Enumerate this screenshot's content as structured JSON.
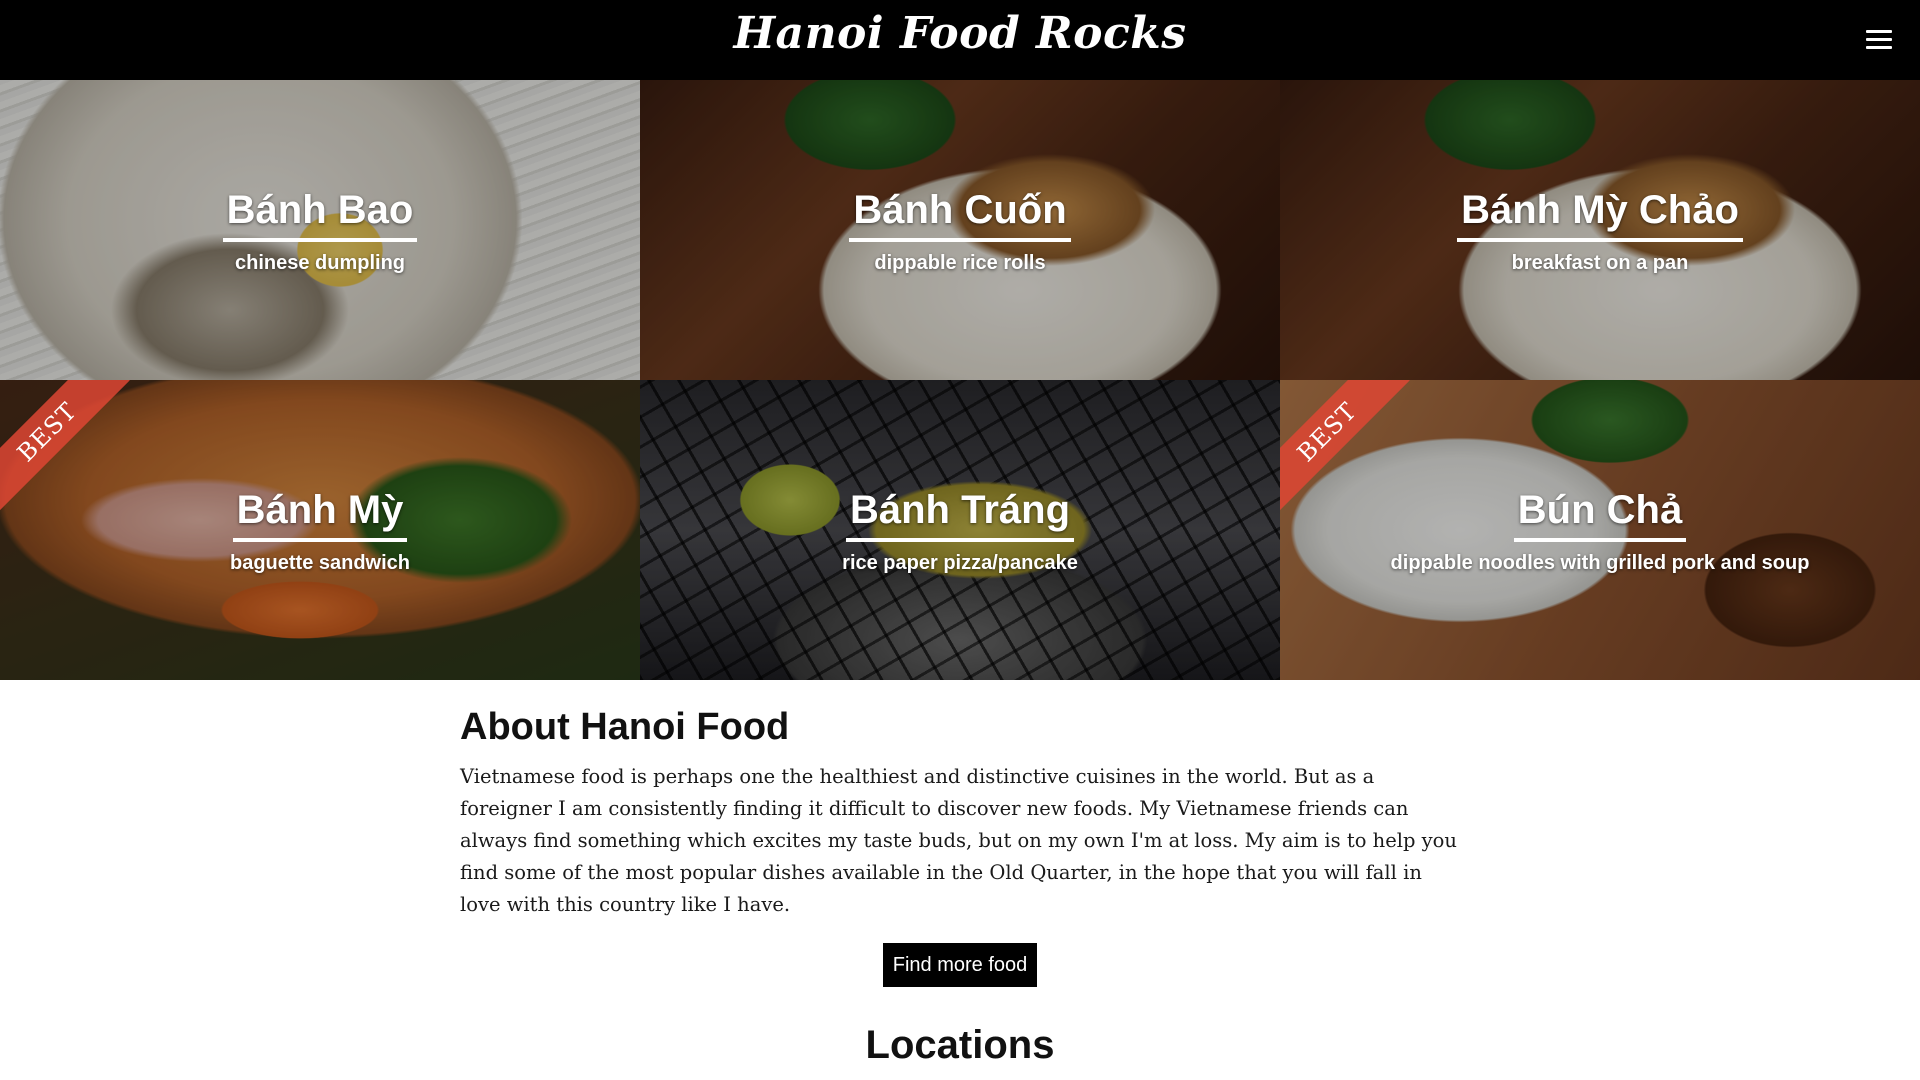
{
  "header": {
    "brand": "Hanoi Food Rocks",
    "menu_icon": "hamburger-menu-icon"
  },
  "foods": [
    {
      "title": "Bánh Bao",
      "subtitle": "chinese dumpling",
      "badge": ""
    },
    {
      "title": "Bánh Cuốn",
      "subtitle": "dippable rice rolls",
      "badge": ""
    },
    {
      "title": "Bánh Mỳ Chảo",
      "subtitle": "breakfast on a pan",
      "badge": ""
    },
    {
      "title": "Bánh Mỳ",
      "subtitle": "baguette sandwich",
      "badge": "BEST"
    },
    {
      "title": "Bánh Tráng",
      "subtitle": "rice paper pizza/pancake",
      "badge": ""
    },
    {
      "title": "Bún Chả",
      "subtitle": "dippable noodles with grilled pork and soup",
      "badge": "BEST"
    }
  ],
  "about": {
    "title": "About Hanoi Food",
    "text": "Vietnamese food is perhaps one the healthiest and distinctive cuisines in the world. But as a foreigner I am consistently finding it difficult to discover new foods. My Vietnamese friends can always find something which excites my taste buds, but on my own I'm at loss. My aim is to help you find some of the most popular dishes available in the Old Quarter, in the hope that you will fall in love with this country like I have.",
    "button_label": "Find more food"
  },
  "locations": {
    "title": "Locations"
  },
  "colors": {
    "header_bg": "#000000",
    "badge_red": "#de4634",
    "button_bg": "#000000"
  }
}
